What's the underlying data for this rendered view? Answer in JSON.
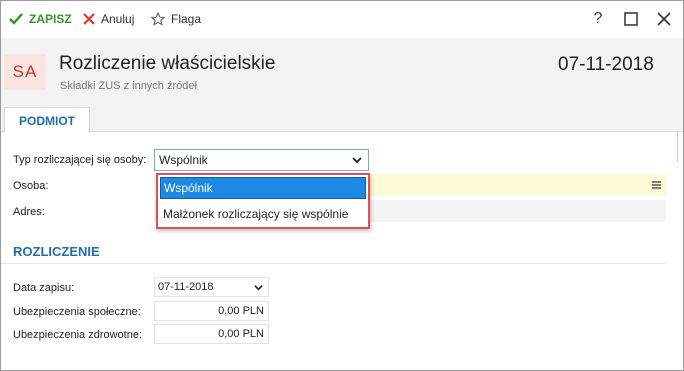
{
  "toolbar": {
    "save_label": "ZAPISZ",
    "cancel_label": "Anuluj",
    "flag_label": "Flaga",
    "help_label": "?"
  },
  "header": {
    "avatar": "SA",
    "title": "Rozliczenie właścicielskie",
    "subtitle": "Składki ZUS z innych źródeł",
    "date": "07-11-2018"
  },
  "tabs": [
    {
      "label": "PODMIOT",
      "active": true
    }
  ],
  "podmiot": {
    "typ_label": "Typ rozliczającej się osoby:",
    "typ_value": "Wspólnik",
    "osoba_label": "Osoba:",
    "osoba_value": "",
    "adres_label": "Adres:",
    "adres_value": "",
    "dropdown_options": [
      "Wspólnik",
      "Małżonek rozliczający się wspólnie"
    ],
    "dropdown_selected": "Wspólnik"
  },
  "rozliczenie": {
    "section_title": "ROZLICZENIE",
    "data_zapisu_label": "Data zapisu:",
    "data_zapisu_value": "07-11-2018",
    "spoleczne_label": "Ubezpieczenia społeczne:",
    "spoleczne_value": "0,00 PLN",
    "zdrowotne_label": "Ubezpieczenia zdrowotne:",
    "zdrowotne_value": "0,00 PLN"
  },
  "colors": {
    "accent": "#1f6fa8",
    "save_green": "#3a8f2d",
    "cancel_red": "#d63b30",
    "selected_blue": "#1e88e5",
    "highlight_red": "#d9534f",
    "required_yellow": "#fdfbd7"
  },
  "icons": {
    "save": "check-icon",
    "cancel": "x-icon",
    "flag": "star-outline-icon",
    "maximize": "square-icon",
    "close": "close-icon",
    "dropdown": "chevron-down-icon",
    "menu": "hamburger-icon"
  }
}
